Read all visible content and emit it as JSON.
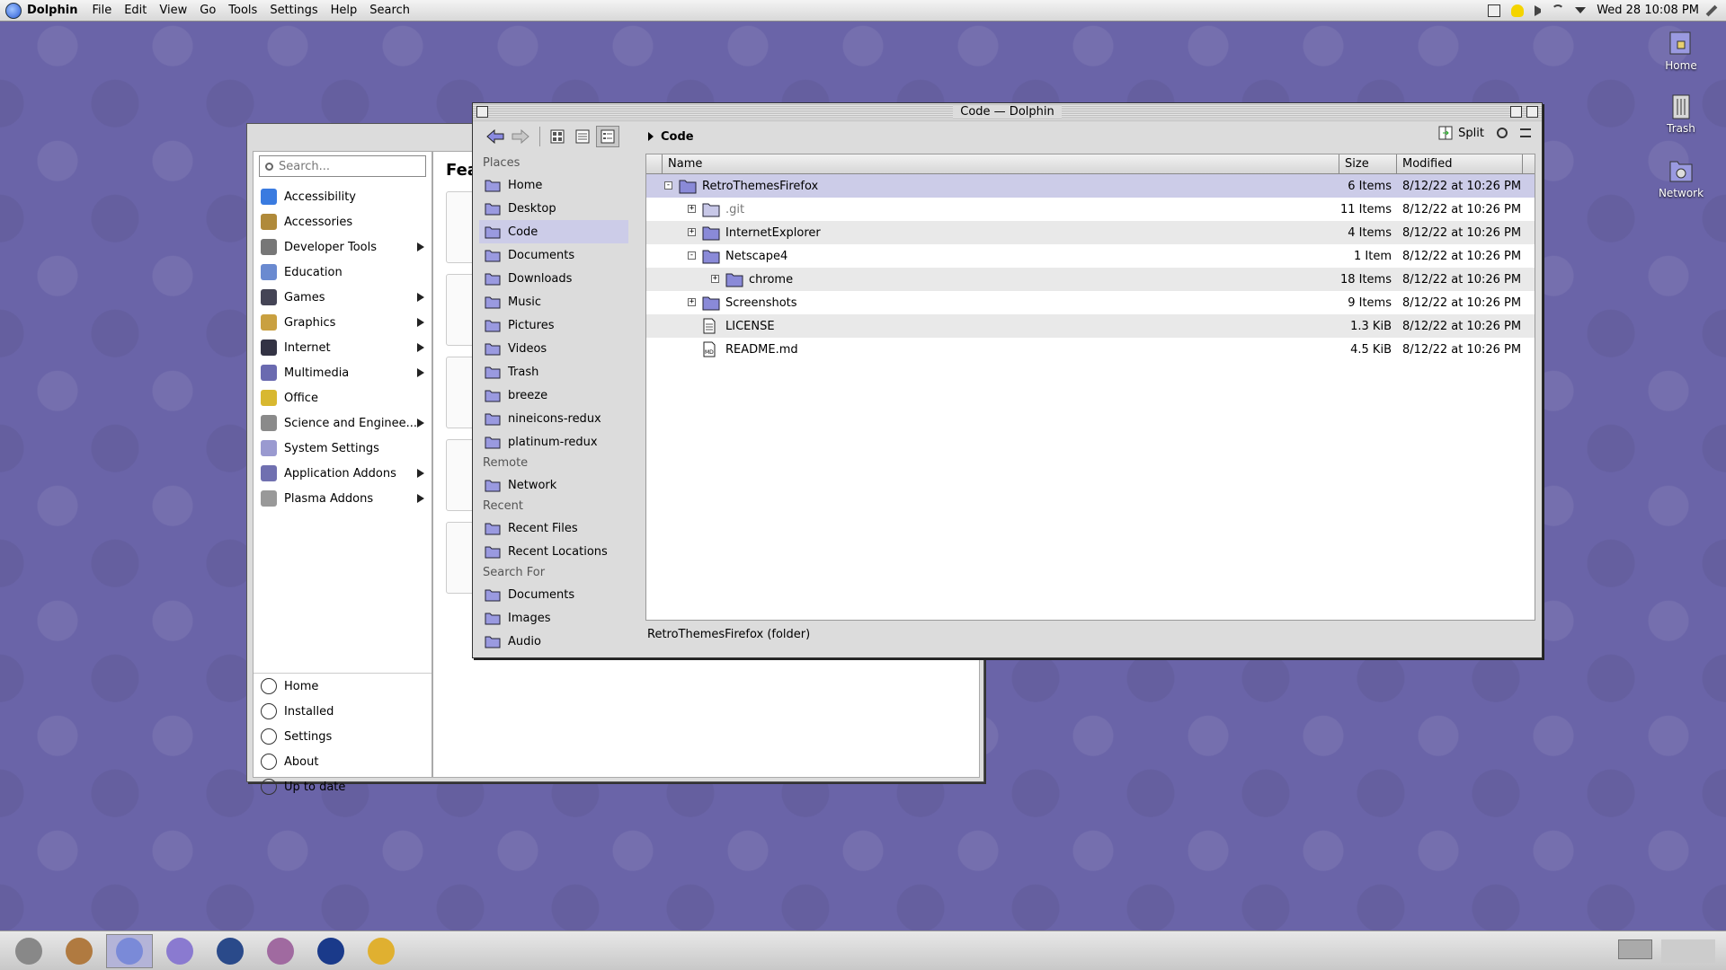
{
  "menubar": {
    "app_name": "Dolphin",
    "items": [
      "File",
      "Edit",
      "View",
      "Go",
      "Tools",
      "Settings",
      "Help",
      "Search"
    ],
    "clock": "Wed 28 10:08 PM"
  },
  "desktop": {
    "icons": [
      {
        "label": "Home",
        "icon": "home-icon"
      },
      {
        "label": "Trash",
        "icon": "trash-icon"
      },
      {
        "label": "Network",
        "icon": "network-icon"
      }
    ]
  },
  "discover": {
    "search_placeholder": "Search...",
    "featured_title": "Feat",
    "categories": [
      {
        "label": "Accessibility",
        "icon": "accessibility-icon",
        "submenu": false
      },
      {
        "label": "Accessories",
        "icon": "accessories-icon",
        "submenu": false
      },
      {
        "label": "Developer Tools",
        "icon": "developer-tools-icon",
        "submenu": true
      },
      {
        "label": "Education",
        "icon": "education-icon",
        "submenu": false
      },
      {
        "label": "Games",
        "icon": "games-icon",
        "submenu": true
      },
      {
        "label": "Graphics",
        "icon": "graphics-icon",
        "submenu": true
      },
      {
        "label": "Internet",
        "icon": "internet-icon",
        "submenu": true
      },
      {
        "label": "Multimedia",
        "icon": "multimedia-icon",
        "submenu": true
      },
      {
        "label": "Office",
        "icon": "office-icon",
        "submenu": false
      },
      {
        "label": "Science and Enginee...",
        "icon": "science-icon",
        "submenu": true
      },
      {
        "label": "System Settings",
        "icon": "system-settings-icon",
        "submenu": false
      },
      {
        "label": "Application Addons",
        "icon": "addons-icon",
        "submenu": true
      },
      {
        "label": "Plasma Addons",
        "icon": "plasma-icon",
        "submenu": true
      }
    ],
    "bottom_items": [
      {
        "label": "Home",
        "icon": "home-icon"
      },
      {
        "label": "Installed",
        "icon": "installed-icon"
      },
      {
        "label": "Settings",
        "icon": "settings-icon"
      },
      {
        "label": "About",
        "icon": "about-icon"
      },
      {
        "label": "Up to date",
        "icon": "update-icon"
      }
    ]
  },
  "dolphin": {
    "title": "Code — Dolphin",
    "breadcrumb": "Code",
    "split_label": "Split",
    "places_sections": [
      {
        "title": "Places",
        "items": [
          {
            "label": "Home",
            "selected": false
          },
          {
            "label": "Desktop",
            "selected": false
          },
          {
            "label": "Code",
            "selected": true
          },
          {
            "label": "Documents",
            "selected": false
          },
          {
            "label": "Downloads",
            "selected": false
          },
          {
            "label": "Music",
            "selected": false
          },
          {
            "label": "Pictures",
            "selected": false
          },
          {
            "label": "Videos",
            "selected": false
          },
          {
            "label": "Trash",
            "selected": false
          },
          {
            "label": "breeze",
            "selected": false
          },
          {
            "label": "nineicons-redux",
            "selected": false
          },
          {
            "label": "platinum-redux",
            "selected": false
          }
        ]
      },
      {
        "title": "Remote",
        "items": [
          {
            "label": "Network",
            "selected": false
          }
        ]
      },
      {
        "title": "Recent",
        "items": [
          {
            "label": "Recent Files",
            "selected": false
          },
          {
            "label": "Recent Locations",
            "selected": false
          }
        ]
      },
      {
        "title": "Search For",
        "items": [
          {
            "label": "Documents",
            "selected": false
          },
          {
            "label": "Images",
            "selected": false
          },
          {
            "label": "Audio",
            "selected": false
          }
        ]
      }
    ],
    "columns": {
      "name": "Name",
      "size": "Size",
      "modified": "Modified"
    },
    "rows": [
      {
        "name": "RetroThemesFirefox",
        "size": "6 Items",
        "modified": "8/12/22 at 10:26 PM",
        "depth": 0,
        "type": "folder",
        "expander": "minus",
        "selected": true
      },
      {
        "name": ".git",
        "size": "11 Items",
        "modified": "8/12/22 at 10:26 PM",
        "depth": 1,
        "type": "folder-hidden",
        "expander": "plus",
        "selected": false
      },
      {
        "name": "InternetExplorer",
        "size": "4 Items",
        "modified": "8/12/22 at 10:26 PM",
        "depth": 1,
        "type": "folder",
        "expander": "plus",
        "selected": false
      },
      {
        "name": "Netscape4",
        "size": "1 Item",
        "modified": "8/12/22 at 10:26 PM",
        "depth": 1,
        "type": "folder",
        "expander": "minus",
        "selected": false
      },
      {
        "name": "chrome",
        "size": "18 Items",
        "modified": "8/12/22 at 10:26 PM",
        "depth": 2,
        "type": "folder",
        "expander": "plus",
        "selected": false
      },
      {
        "name": "Screenshots",
        "size": "9 Items",
        "modified": "8/12/22 at 10:26 PM",
        "depth": 1,
        "type": "folder",
        "expander": "plus",
        "selected": false
      },
      {
        "name": "LICENSE",
        "size": "1.3 KiB",
        "modified": "8/12/22 at 10:26 PM",
        "depth": 1,
        "type": "file",
        "expander": "none",
        "selected": false
      },
      {
        "name": "README.md",
        "size": "4.5 KiB",
        "modified": "8/12/22 at 10:26 PM",
        "depth": 1,
        "type": "markdown",
        "expander": "none",
        "selected": false
      }
    ],
    "status": "RetroThemesFirefox (folder)"
  },
  "taskbar": {
    "tasks": [
      {
        "icon": "system-monitor-icon",
        "active": false
      },
      {
        "icon": "mail-icon",
        "active": false
      },
      {
        "icon": "finder-icon",
        "active": true
      },
      {
        "icon": "browser-icon",
        "active": false
      },
      {
        "icon": "window-icon",
        "active": false
      },
      {
        "icon": "media-icon",
        "active": false
      },
      {
        "icon": "bitwarden-icon",
        "active": false
      },
      {
        "icon": "writer-icon",
        "active": false
      }
    ]
  },
  "colors": {
    "desktop": "#6a64a8",
    "selection": "#cccce8",
    "folder": "#7b7bc0"
  }
}
